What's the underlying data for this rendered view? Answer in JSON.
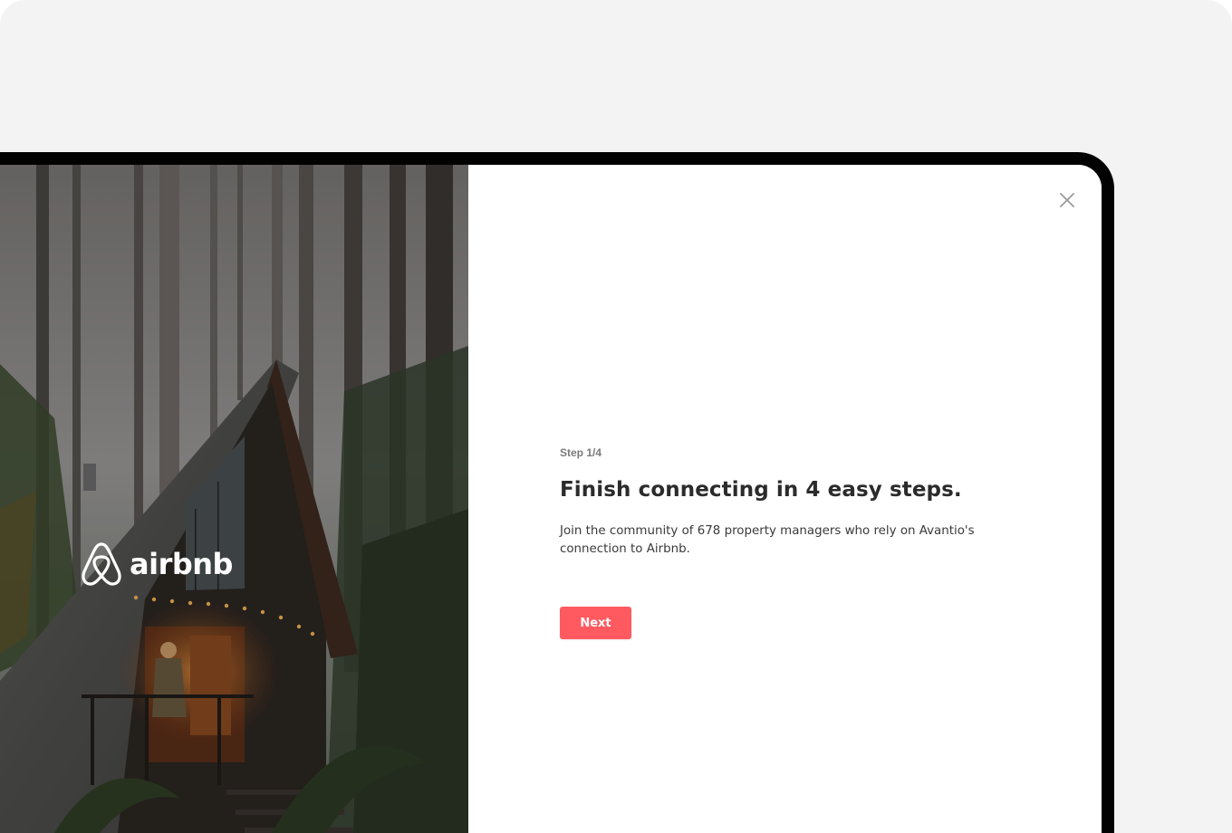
{
  "hero": {
    "brand": "airbnb",
    "brand_icon": "airbnb-logo-icon"
  },
  "dialog": {
    "close_icon": "close-icon",
    "step_label": "Step 1/4",
    "title": "Finish connecting in 4 easy steps.",
    "description": "Join the community of 678 property managers who rely on Avantio's connection to Airbnb.",
    "next_label": "Next"
  },
  "colors": {
    "accent": "#ff5a5f",
    "background": "#f3f3f3",
    "device_frame": "#020202"
  }
}
